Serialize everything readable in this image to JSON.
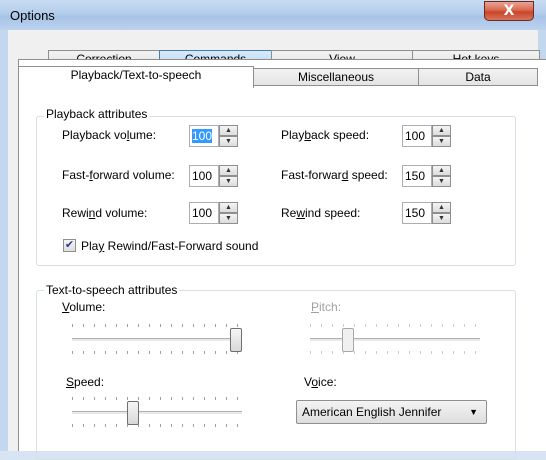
{
  "window": {
    "title": "Options",
    "close_glyph": "X"
  },
  "tabs_row1": [
    {
      "label": "Correction"
    },
    {
      "label": "Commands"
    },
    {
      "label": "View"
    },
    {
      "label": "Hot keys"
    }
  ],
  "tabs_row2": [
    {
      "label": "Playback/Text-to-speech",
      "active": true
    },
    {
      "label": "Miscellaneous"
    },
    {
      "label": "Data"
    }
  ],
  "playback": {
    "group_label": "Playback attributes",
    "playback_volume": {
      "label_pre": "Playback vo",
      "mnemonic": "l",
      "label_post": "ume:",
      "value": "100"
    },
    "playback_speed": {
      "label_pre": "Play",
      "mnemonic": "b",
      "label_post": "ack speed:",
      "value": "100"
    },
    "ff_volume": {
      "label_pre": "Fast-",
      "mnemonic": "f",
      "label_post": "orward volume:",
      "value": "100"
    },
    "ff_speed": {
      "label_pre": "Fast-forwar",
      "mnemonic": "d",
      "label_post": " speed:",
      "value": "150"
    },
    "rewind_volume": {
      "label_pre": "Rewi",
      "mnemonic": "n",
      "label_post": "d volume:",
      "value": "100"
    },
    "rewind_speed": {
      "label_pre": "Re",
      "mnemonic": "w",
      "label_post": "ind speed:",
      "value": "150"
    },
    "rewind_sound": {
      "label_pre": "Pla",
      "mnemonic": "y",
      "label_post": " Rewind/Fast-Forward sound",
      "checked": true,
      "check_glyph": "✔"
    }
  },
  "tts": {
    "group_label": "Text-to-speech attributes",
    "volume": {
      "mnemonic": "V",
      "label_post": "olume:",
      "level": 1.0
    },
    "pitch": {
      "mnemonic": "P",
      "label_post": "itch:",
      "level": 0.2,
      "disabled": true
    },
    "speed": {
      "mnemonic": "S",
      "label_post": "peed:",
      "level": 0.35
    },
    "voice": {
      "label_pre": "V",
      "mnemonic": "o",
      "label_post": "ice:",
      "selected": "American English Jennifer",
      "arrow": "▼"
    }
  },
  "icons": {
    "spin_up": "▲",
    "spin_down": "▼"
  }
}
